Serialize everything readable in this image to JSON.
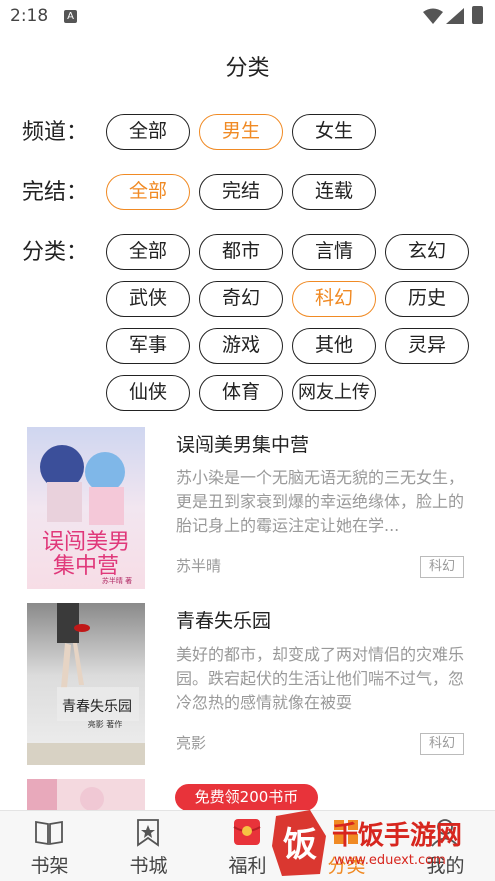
{
  "status_bar": {
    "time": "2:18",
    "notif_glyph": "A"
  },
  "page": {
    "title": "分类"
  },
  "filters": {
    "channel": {
      "label": "频道：",
      "options": [
        "全部",
        "男生",
        "女生"
      ],
      "selected": "男生"
    },
    "completion": {
      "label": "完结：",
      "options": [
        "全部",
        "完结",
        "连载"
      ],
      "selected": "全部"
    },
    "category": {
      "label": "分类：",
      "options": [
        "全部",
        "都市",
        "言情",
        "玄幻",
        "武侠",
        "奇幻",
        "科幻",
        "历史",
        "军事",
        "游戏",
        "其他",
        "灵异",
        "仙侠",
        "体育",
        "网友上传"
      ],
      "selected": "科幻"
    }
  },
  "books": [
    {
      "title": "误闯美男集中营",
      "description": "苏小染是一个无脑无语无貌的三无女生，更是丑到家衰到爆的幸运绝缘体，脸上的胎记身上的霉运注定让她在学...",
      "author": "苏半晴",
      "tag": "科幻",
      "cover_text": "误闯美男集中营",
      "cover_sub": "苏半晴 著"
    },
    {
      "title": "青春失乐园",
      "description": "美好的都市，却变成了两对情侣的灾难乐园。跌宕起伏的生活让他们喘不过气，忽冷忽热的感情就像在被耍",
      "author": "亮影",
      "tag": "科幻",
      "cover_text": "青春失乐园",
      "cover_sub": "亮影 著作"
    }
  ],
  "promo": {
    "label": "免费领200书币"
  },
  "bottom_nav": [
    {
      "label": "书架",
      "icon": "book-open-icon"
    },
    {
      "label": "书城",
      "icon": "bookmark-star-icon"
    },
    {
      "label": "福利",
      "icon": "red-envelope-icon"
    },
    {
      "label": "分类",
      "icon": "category-icon"
    },
    {
      "label": "我的",
      "icon": "user-icon"
    }
  ],
  "watermark": {
    "brand": "千饭手游网",
    "url": "www.eduext.com",
    "glyph": "饭"
  },
  "colors": {
    "accent": "#f08a24",
    "promo": "#e8333a",
    "text": "#222222",
    "muted": "#999999"
  }
}
